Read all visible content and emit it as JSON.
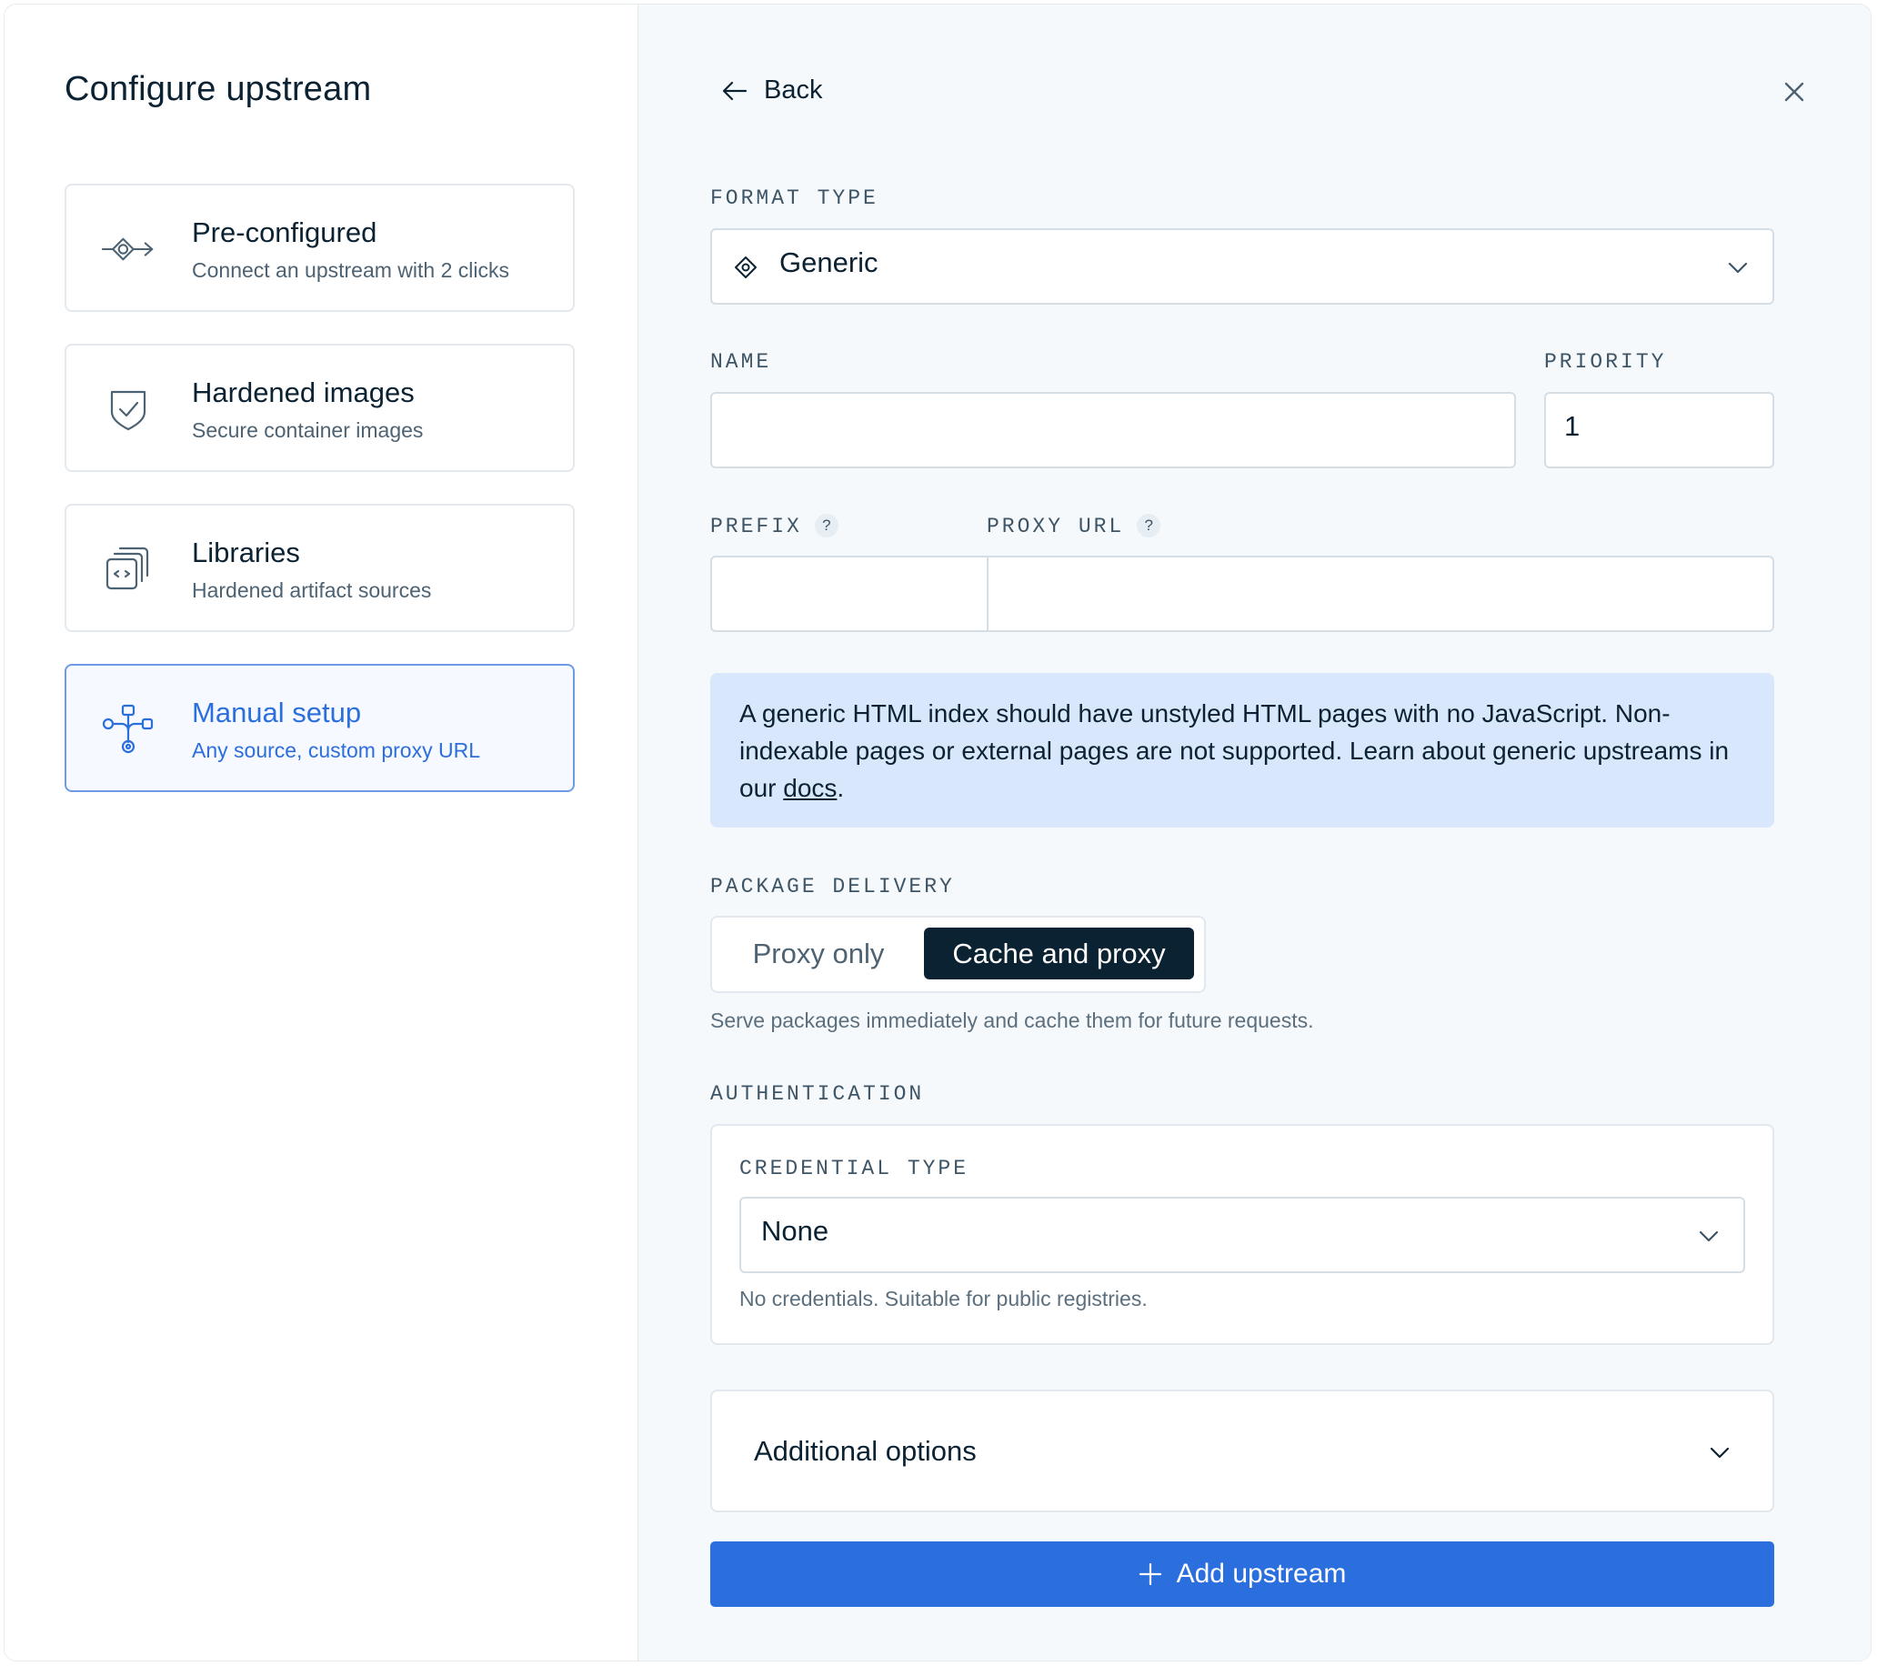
{
  "left_panel": {
    "title": "Configure upstream",
    "cards": [
      {
        "title": "Pre-configured",
        "subtitle": "Connect an upstream with 2 clicks",
        "icon": "plug-eye-icon"
      },
      {
        "title": "Hardened images",
        "subtitle": "Secure container images",
        "icon": "shield-check-icon"
      },
      {
        "title": "Libraries",
        "subtitle": "Hardened artifact sources",
        "icon": "stacked-code-icon"
      },
      {
        "title": "Manual setup",
        "subtitle": "Any source, custom proxy URL",
        "icon": "network-tree-icon",
        "active": true
      }
    ]
  },
  "header": {
    "back_label": "Back"
  },
  "form": {
    "format_type": {
      "label": "FORMAT TYPE",
      "value": "Generic",
      "icon": "diamond-icon"
    },
    "name": {
      "label": "NAME",
      "value": "",
      "placeholder": ""
    },
    "priority": {
      "label": "PRIORITY",
      "value": "1"
    },
    "prefix": {
      "label": "PREFIX",
      "help": "?",
      "value": ""
    },
    "proxy_url": {
      "label": "PROXY URL",
      "help": "?",
      "value": ""
    },
    "info": {
      "text": "A generic HTML index should have unstyled HTML pages with no JavaScript. Non-indexable pages or external pages are not supported. Learn about generic upstreams in our ",
      "link": "docs",
      "end": "."
    },
    "package_delivery": {
      "label": "PACKAGE DELIVERY",
      "options": [
        "Proxy only",
        "Cache and proxy"
      ],
      "selected": "Cache and proxy",
      "hint": "Serve packages immediately and cache them for future requests."
    },
    "authentication": {
      "label": "AUTHENTICATION",
      "credential_type_label": "CREDENTIAL TYPE",
      "credential_type_value": "None",
      "hint": "No credentials. Suitable for public registries."
    },
    "additional_options": {
      "label": "Additional options"
    },
    "submit": {
      "label": "Add upstream"
    }
  },
  "colors": {
    "accent": "#2a6fdd",
    "dark": "#0b2233",
    "info_bg": "#d9e7fc",
    "active_border": "#6f9ae6"
  }
}
